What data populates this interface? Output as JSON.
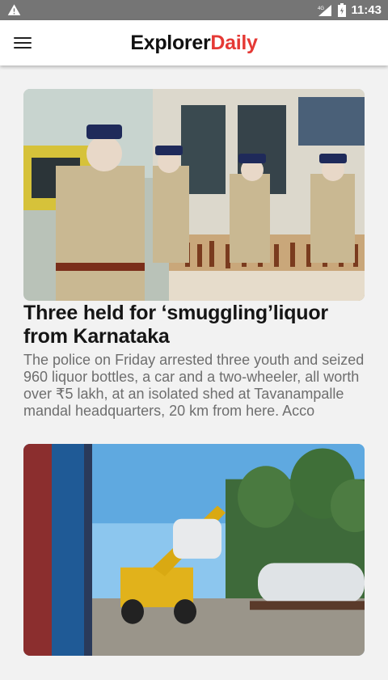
{
  "status": {
    "time": "11:43",
    "network": "4G"
  },
  "app": {
    "brand_primary": "Explorer",
    "brand_accent": "Daily",
    "accent_color": "#e53935"
  },
  "articles": [
    {
      "title": "Three held for ‘smuggling’liquor from Karnataka",
      "body": "The police on Friday arrested three youth and seized 960 liquor bottles, a car and a two-wheeler, all worth over ₹5 lakh, at an isolated shed at Tavanampalle mandal headquarters, 20 km from here. Acco"
    },
    {
      "title": "",
      "body": ""
    }
  ]
}
